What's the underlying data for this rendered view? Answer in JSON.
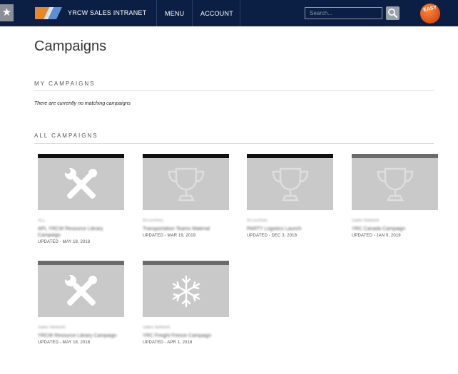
{
  "header": {
    "brand": "YRCW SALES INTRANET",
    "nav": [
      "MENU",
      "ACCOUNT"
    ],
    "search_placeholder": "Search...",
    "easy_label": "EASY",
    "favorite_glyph": "★"
  },
  "page": {
    "title": "Campaigns",
    "my_campaigns_heading": "MY CAMPAIGNS",
    "my_campaigns_empty": "There are currently no matching campaigns",
    "all_campaigns_heading": "ALL CAMPAIGNS"
  },
  "campaigns": [
    {
      "icon": "tools-icon",
      "category": "ALL",
      "name": "APL YRCW Resource Library Campaign",
      "updated": "UPDATED - MAY 18, 2018"
    },
    {
      "icon": "trophy-icon",
      "category": "INTERNAL",
      "name": "Transportation Teams Material",
      "updated": "UPDATED - MAR 19, 2019"
    },
    {
      "icon": "trophy-icon",
      "category": "INTERNAL",
      "name": "PARTY Logistics Launch",
      "updated": "UPDATED - DEC 3, 2018"
    },
    {
      "icon": "trophy-icon",
      "category": "Sales Network",
      "name": "YRC Canada Campaign",
      "updated": "UPDATED - JAN 9, 2019"
    },
    {
      "icon": "tools-icon",
      "category": "Sales Network",
      "name": "YRCW Resource Library Campaign",
      "updated": "UPDATED - MAY 18, 2018"
    },
    {
      "icon": "snowflake-icon",
      "category": "Sales Network",
      "name": "YRC Freight Freeze Campaign",
      "updated": "UPDATED - APR 1, 2018"
    }
  ],
  "colors": {
    "nav_bg": "#0b1f44",
    "thumb_bg": "#c9c9c9",
    "accent_orange": "#e0561a"
  }
}
